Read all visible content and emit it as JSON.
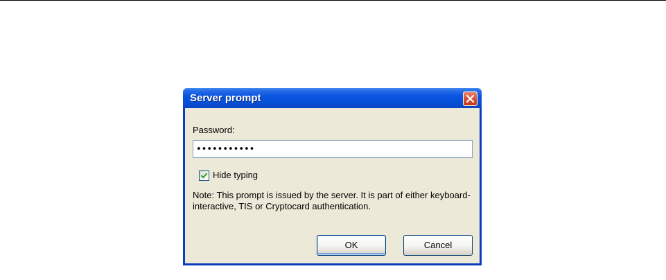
{
  "dialog": {
    "title": "Server prompt",
    "close_icon": "close-icon",
    "password_label": "Password:",
    "password_masked": "•••••••••••",
    "hide_typing": {
      "label": "Hide typing",
      "checked": true
    },
    "note": "Note: This prompt is issued by the server. It is part of either keyboard-interactive, TIS or Cryptocard authentication.",
    "ok_label": "OK",
    "cancel_label": "Cancel"
  },
  "colors": {
    "titlebar": "#0652d8",
    "client_background": "#ece9d8",
    "close_button": "#d8553a",
    "check_mark": "#21a121"
  }
}
